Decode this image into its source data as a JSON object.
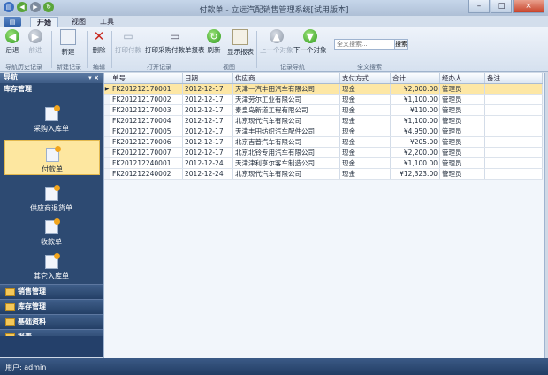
{
  "window": {
    "title": "付款单 - 立远汽配销售管理系统[试用版本]",
    "controls": [
      "–",
      "□",
      "×"
    ]
  },
  "tabs": [
    {
      "label": "开始",
      "active": true
    },
    {
      "label": "视图",
      "active": false
    },
    {
      "label": "工具",
      "active": false
    }
  ],
  "ribbon": {
    "back": "后退",
    "forward": "前进",
    "new": "新建",
    "delete": "删除",
    "print_record": "打印付款",
    "print_purchase_report": "打印采购付款单报表",
    "refresh": "刷新",
    "show_report": "显示报表",
    "prev_record": "上一个对象",
    "next_record": "下一个对象",
    "search_placeholder": "全文搜索...",
    "search_button": "搜索",
    "groups": {
      "nav_history": "导航历史记录",
      "new_record": "新建记录",
      "edit": "编辑",
      "print_record": "打开记录",
      "view": "视图",
      "record_nav": "记录导航",
      "fulltext": "全文搜索"
    }
  },
  "sidebar": {
    "header": "导航",
    "pin": "▾ ×",
    "group_title": "库存管理",
    "items": [
      {
        "label": "采购入库单",
        "active": false
      },
      {
        "label": "付款单",
        "active": true
      },
      {
        "label": "供应商退货单",
        "active": false
      },
      {
        "label": "收款单",
        "active": false
      },
      {
        "label": "其它入库单",
        "active": false
      }
    ],
    "scroll": "▼",
    "groups": [
      "销售管理",
      "库存管理",
      "基础资料",
      "报表"
    ]
  },
  "table": {
    "columns": [
      "单号",
      "日期",
      "供应商",
      "支付方式",
      "合计",
      "经办人",
      "备注"
    ],
    "rows": [
      [
        "FK201212170001",
        "2012-12-17",
        "天津一汽丰田汽车有限公司",
        "现金",
        "¥2,000.00",
        "管理员",
        ""
      ],
      [
        "FK201212170002",
        "2012-12-17",
        "天津劳尔工业有限公司",
        "现金",
        "¥1,100.00",
        "管理员",
        ""
      ],
      [
        "FK201212170003",
        "2012-12-17",
        "秦皇岛新道工程有限公司",
        "现金",
        "¥110.00",
        "管理员",
        ""
      ],
      [
        "FK201212170004",
        "2012-12-17",
        "北京现代汽车有限公司",
        "现金",
        "¥1,100.00",
        "管理员",
        ""
      ],
      [
        "FK201212170005",
        "2012-12-17",
        "天津丰田纺织汽车配件公司",
        "现金",
        "¥4,950.00",
        "管理员",
        ""
      ],
      [
        "FK201212170006",
        "2012-12-17",
        "北京吉普汽车有限公司",
        "现金",
        "¥205.00",
        "管理员",
        ""
      ],
      [
        "FK201212170007",
        "2012-12-17",
        "北京北铃专用汽车有限公司",
        "现金",
        "¥2,200.00",
        "管理员",
        ""
      ],
      [
        "FK201212240001",
        "2012-12-24",
        "天津津利亨尔客车制造公司",
        "现金",
        "¥1,100.00",
        "管理员",
        ""
      ],
      [
        "FK201212240002",
        "2012-12-24",
        "北京现代汽车有限公司",
        "现金",
        "¥12,323.00",
        "管理员",
        ""
      ]
    ],
    "selected_row": 0,
    "row_marker": "▶"
  },
  "status": {
    "user": "用户: admin"
  }
}
